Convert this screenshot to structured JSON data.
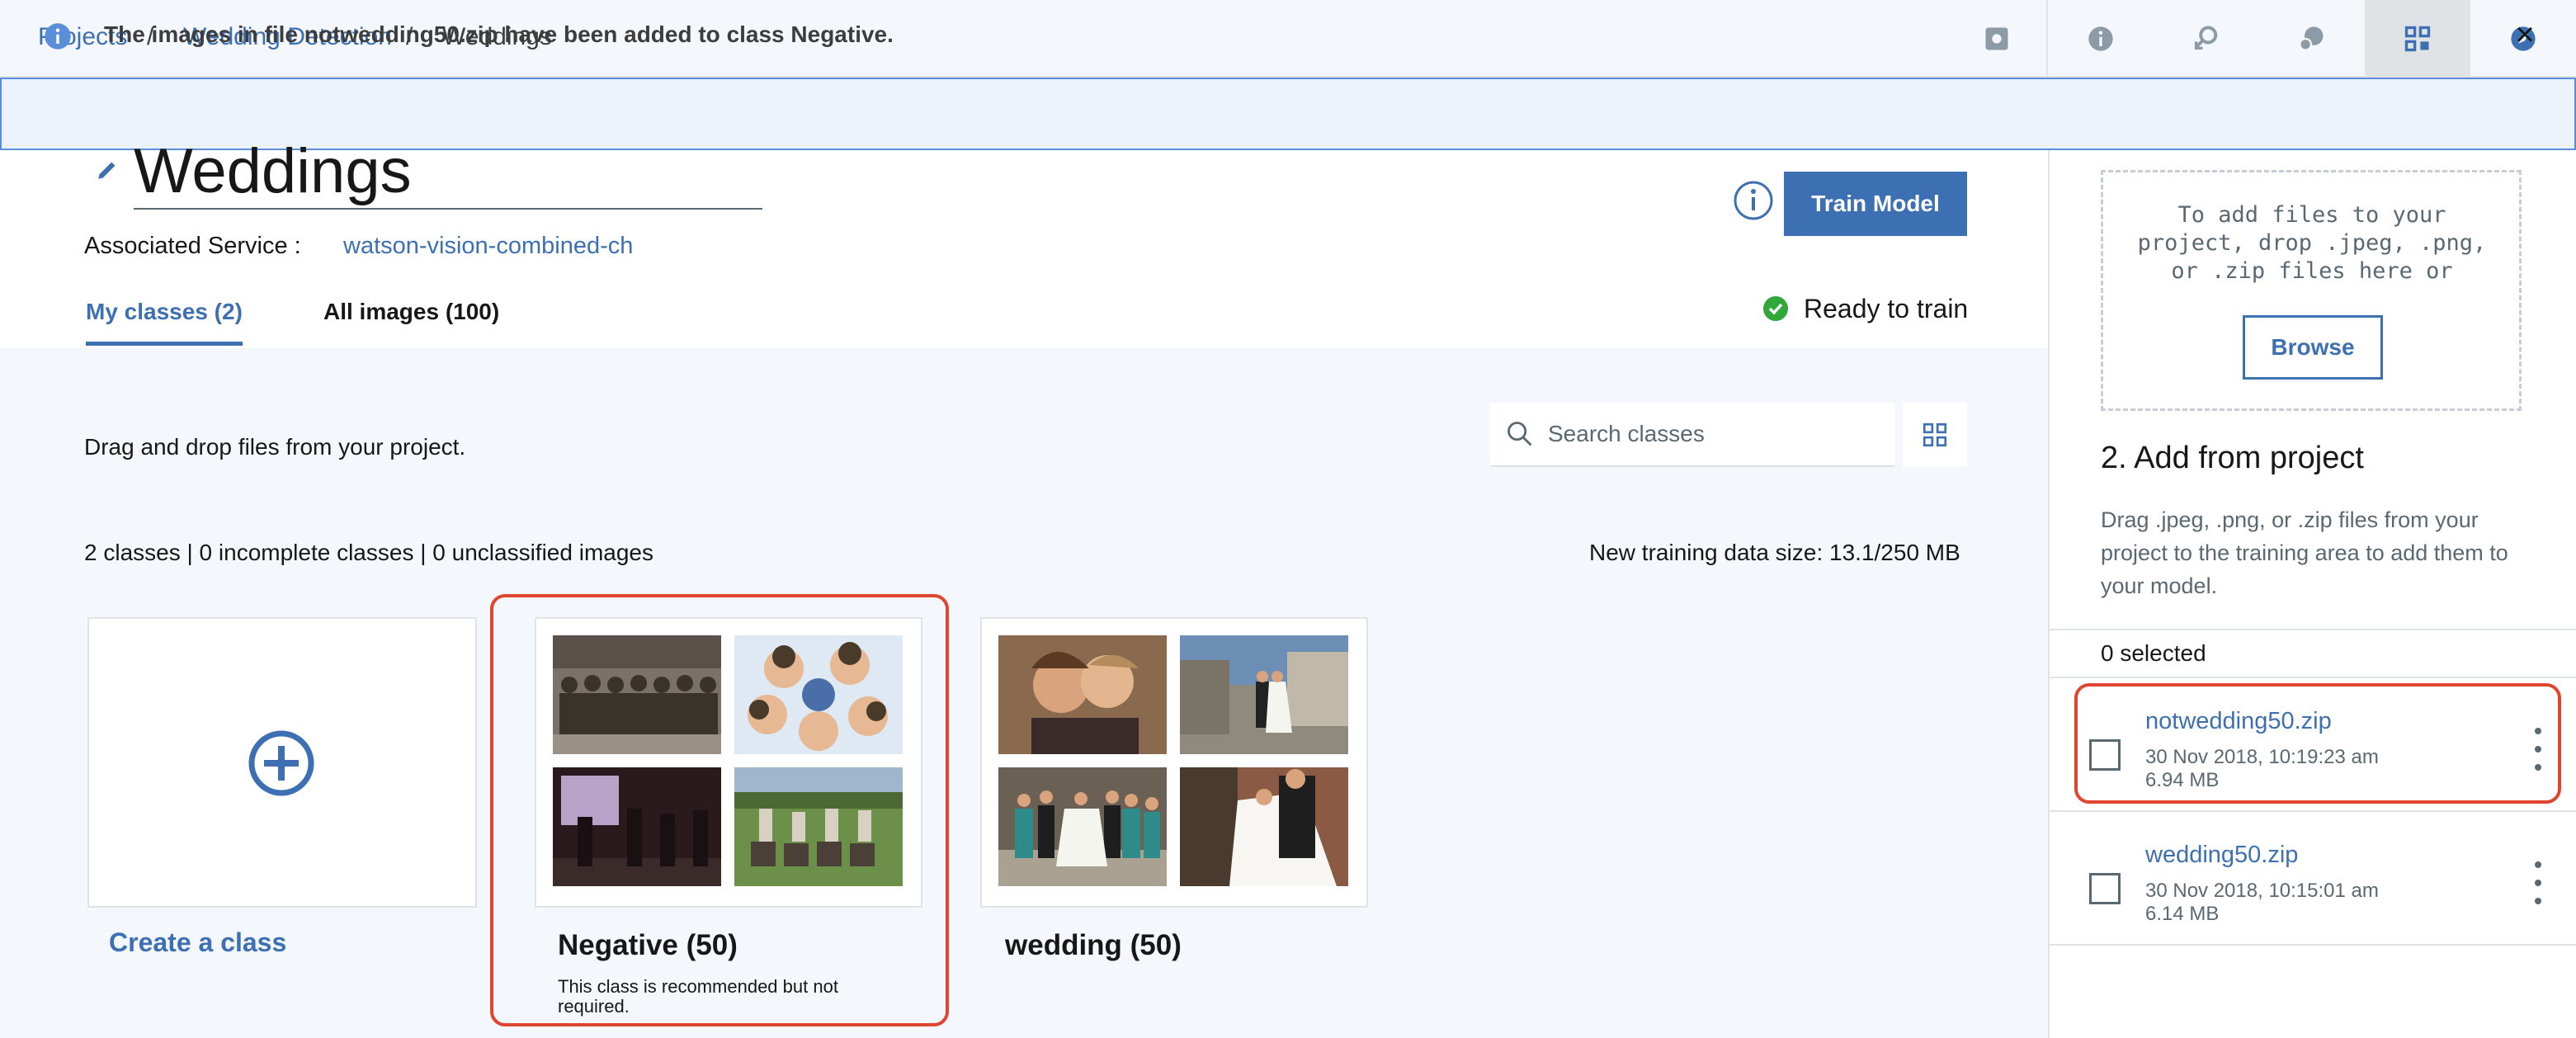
{
  "breadcrumb": {
    "items": [
      "Projects",
      "Wedding Detection",
      "Weddings"
    ],
    "separator": "/"
  },
  "toolbar": {
    "icons": [
      "settings-box-icon",
      "info-icon",
      "api-icon",
      "help-chat-icon",
      "project-assets-icon",
      "compass-icon"
    ],
    "active_icon": "project-assets-icon"
  },
  "notification": {
    "text": "The images in file notwedding50.zip have been added to class Negative.",
    "close_symbol": "×",
    "kind": "info"
  },
  "header": {
    "title": "Weddings",
    "associated_service_label": "Associated Service :",
    "associated_service_value": "watson-vision-combined-ch",
    "train_button": "Train Model",
    "status": "Ready to train"
  },
  "tabs": [
    {
      "label": "My classes (2)",
      "active": true
    },
    {
      "label": "All images (100)",
      "active": false
    }
  ],
  "main": {
    "drag_hint": "Drag and drop files from your project.",
    "search_placeholder": "Search classes",
    "stats": "2 classes | 0 incomplete classes | 0 unclassified images",
    "training_size": "New training data size: 13.1/250 MB",
    "create_class_label": "Create a class",
    "classes": [
      {
        "name": "Negative (50)",
        "note": "This class is recommended but not required.",
        "highlighted": true,
        "thumbnails": [
          "group-photo-sepia",
          "smiling-circle-of-friends",
          "people-indoors-dark",
          "group-outdoors-car"
        ]
      },
      {
        "name": "wedding (50)",
        "note": "",
        "highlighted": false,
        "thumbnails": [
          "couple-kissing",
          "couple-on-street",
          "wedding-party-group",
          "bride-and-groom"
        ]
      }
    ]
  },
  "right_panel": {
    "drop_text": "To add files to your project, drop .jpeg, .png, or .zip files here or",
    "browse_button": "Browse",
    "add_heading": "2. Add from project",
    "add_description": "Drag .jpeg, .png, or .zip files from your project to the training area to add them to your model.",
    "selected_count": "0 selected",
    "files": [
      {
        "name": "notwedding50.zip",
        "date": "30 Nov 2018, 10:19:23 am",
        "size": "6.94 MB",
        "highlighted": true
      },
      {
        "name": "wedding50.zip",
        "date": "30 Nov 2018, 10:15:01 am",
        "size": "6.14 MB",
        "highlighted": false
      }
    ]
  },
  "colors": {
    "accent": "#3d70b2",
    "success": "#2fa838",
    "highlight": "#e0462f",
    "info_bg": "#ebf2fb"
  }
}
